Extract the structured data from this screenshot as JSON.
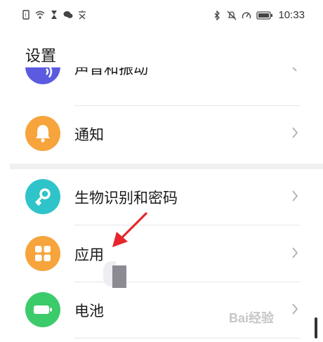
{
  "status_bar": {
    "time": "10:33",
    "left_icons": [
      "sim-icon",
      "wifi-icon",
      "hourglass-icon",
      "chat-icon",
      "text-icon"
    ],
    "right_icons": [
      "bluetooth-icon",
      "mute-icon",
      "speed-icon",
      "battery-icon"
    ]
  },
  "header": {
    "title": "设置"
  },
  "settings": {
    "items": [
      {
        "label": "声音和振动",
        "icon": "sound-icon",
        "color": "#5b5be0"
      },
      {
        "label": "通知",
        "icon": "bell-icon",
        "color": "#f6a43b"
      },
      {
        "label": "生物识别和密码",
        "icon": "key-icon",
        "color": "#2ec4c9"
      },
      {
        "label": "应用",
        "icon": "apps-grid-icon",
        "color": "#f6a43b"
      },
      {
        "label": "电池",
        "icon": "battery-icon",
        "color": "#3ccb6a"
      }
    ]
  },
  "annotation": {
    "arrow_color": "#e5262b"
  },
  "watermark": {
    "text": "Bai经验",
    "logo": "baidu-logo"
  }
}
